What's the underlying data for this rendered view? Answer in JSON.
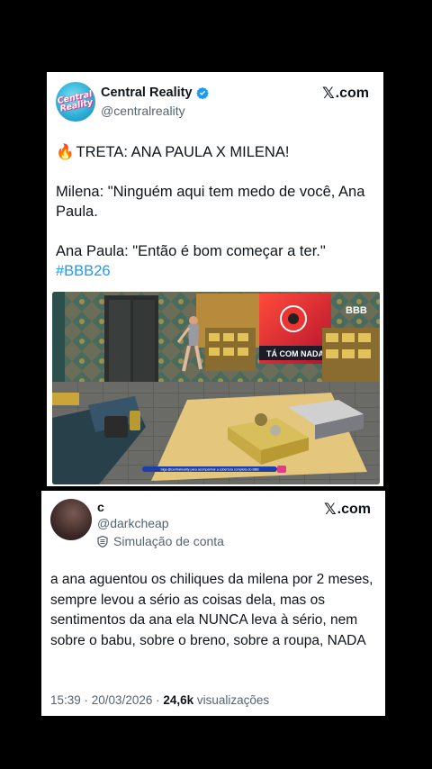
{
  "tweet": {
    "author_name": "Central Reality",
    "handle": "@centralreality",
    "avatar_text": "Central Reality",
    "site_label": ".com",
    "headline": "TRETA: ANA PAULA X MILENA!",
    "line1": "Milena: \"Ninguém aqui tem medo de você, Ana Paula.",
    "line2": "Ana Paula: \"Então é bom começar a ter.\"",
    "hashtag": "#BBB26",
    "media": {
      "screen_text": "TÁ COM NADA",
      "logo_text": "BBB",
      "caption_text": "Siga @centralreality para acompanhar a cobertura completa do BBB"
    }
  },
  "reply": {
    "author_name": "c",
    "handle": "@darkcheap",
    "badge_label": "Simulação de conta",
    "site_label": ".com",
    "text": "a ana aguentou os chiliques da milena por 2 meses, sempre levou a sério as coisas dela, mas os sentimentos da ana ela NUNCA leva à sério, nem sobre o babu, sobre o breno, sobre a roupa, NADA",
    "time": "15:39 · 20/03/2026 · ",
    "views_count": "24,6k",
    "views_label": " visualizações"
  },
  "colors": {
    "background": "#000000",
    "link": "#1d9bf0",
    "verified": "#1d9bf0",
    "muted_text": "#536471"
  },
  "icons": [
    "verified-badge-icon",
    "x-logo-icon",
    "fire-emoji-icon",
    "shield-icon"
  ]
}
